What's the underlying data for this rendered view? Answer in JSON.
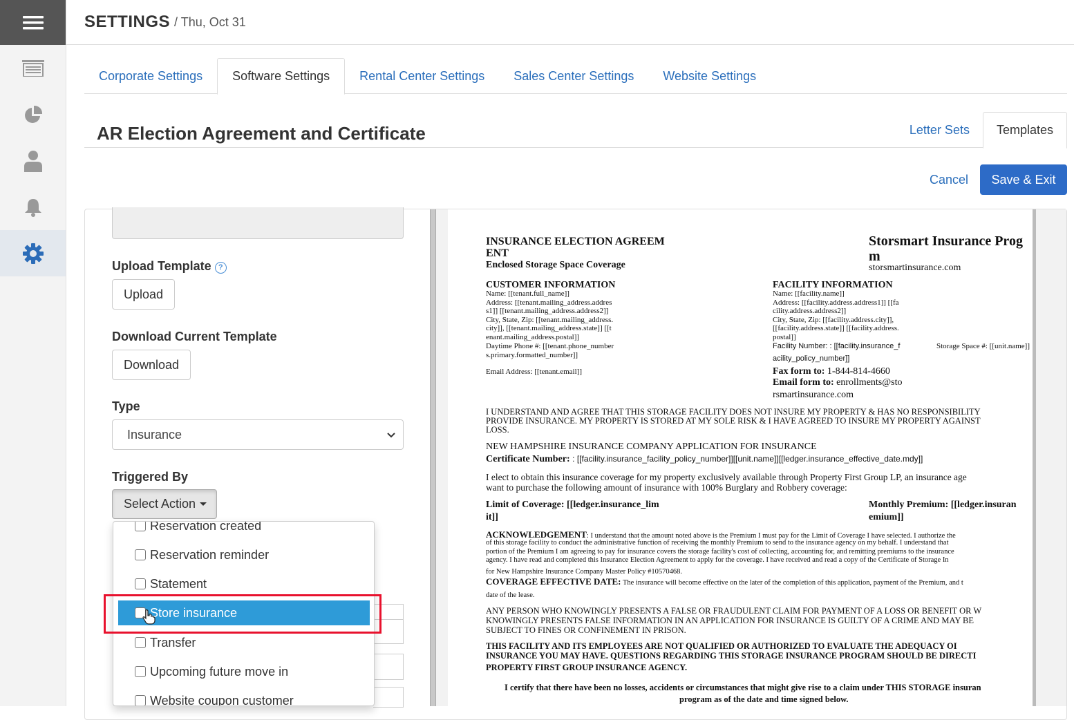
{
  "header": {
    "title": "SETTINGS",
    "date": "/ Thu, Oct 31"
  },
  "sidebar": {
    "icons": [
      "menu-icon",
      "list-icon",
      "pie-chart-icon",
      "user-icon",
      "bell-icon",
      "gear-icon"
    ]
  },
  "tabs": [
    {
      "label": "Corporate Settings"
    },
    {
      "label": "Software Settings",
      "active": true
    },
    {
      "label": "Rental Center Settings"
    },
    {
      "label": "Sales Center Settings"
    },
    {
      "label": "Website Settings"
    }
  ],
  "page": {
    "title": "AR Election Agreement and Certificate",
    "subtabs": [
      {
        "label": "Letter Sets"
      },
      {
        "label": "Templates",
        "active": true
      }
    ],
    "cancel": "Cancel",
    "save": "Save & Exit"
  },
  "form": {
    "upload_label": "Upload Template",
    "upload_btn": "Upload",
    "download_label": "Download Current Template",
    "download_btn": "Download",
    "type_label": "Type",
    "type_value": "Insurance",
    "triggered_label": "Triggered By",
    "action_btn": "Select Action",
    "actions": [
      {
        "label": "Reservation created",
        "checked": false
      },
      {
        "label": "Reservation reminder",
        "checked": false
      },
      {
        "label": "Statement",
        "checked": false
      },
      {
        "label": "Store insurance",
        "checked": false,
        "highlighted": true
      },
      {
        "label": "Transfer",
        "checked": false
      },
      {
        "label": "Upcoming future move in",
        "checked": false
      },
      {
        "label": "Website coupon customer",
        "checked": false
      }
    ]
  },
  "doc": {
    "title1": "INSURANCE ELECTION AGREEM",
    "title2": "ENT",
    "subtitle": "Enclosed Storage Space Coverage",
    "prog1": "Storsmart Insurance Prog",
    "prog2": "m",
    "site": "storsmartinsurance.com",
    "cust_h": "CUSTOMER INFORMATION",
    "cust_lines": [
      "Name: [[tenant.full_name]]",
      "Address: [[tenant.mailing_address.addres",
      "s1]] [[tenant.mailing_address.address2]]",
      "City, State, Zip: [[tenant.mailing_address.",
      "city]], [[tenant.mailing_address.state]] [[t",
      "enant.mailing_address.postal]]",
      "Daytime Phone #: [[tenant.phone_number",
      "s.primary.formatted_number]]"
    ],
    "cust_email": "Email Address: [[tenant.email]]",
    "fac_h": "FACILITY INFORMATION",
    "fac_lines": [
      "Name: [[facility.name]]",
      "Address: [[facility.address.address1]] [[fa",
      "cility.address.address2]]",
      "City, State, Zip: [[facility.address.city]],",
      "[[facility.address.state]] [[facility.address.",
      "postal]]"
    ],
    "fac_num": "Facility Number: : [[facility.insurance_f",
    "fac_space": "Storage Space #: [[unit.name]]",
    "fac_num2": "acility_policy_number]]",
    "fax_label": "Fax form to:",
    "fax_value": "1-844-814-4660",
    "email_label": "Email form to:",
    "email_value": "enrollments@sto",
    "email_value2": "rsmartinsurance.com",
    "understand": [
      "I UNDERSTAND AND AGREE THAT THIS STORAGE FACILITY DOES NOT INSURE MY PROPERTY & HAS NO RESPONSIBILITY",
      "PROVIDE INSURANCE.  MY PROPERTY IS STORED AT MY SOLE RISK & I HAVE AGREED TO INSURE MY PROPERTY AGAINST",
      "LOSS."
    ],
    "nh": "NEW HAMPSHIRE INSURANCE COMPANY APPLICATION FOR INSURANCE",
    "cert_label": "Certificate Number:",
    "cert_value": ": [[facility.insurance_facility_policy_number]][[unit.name]][[ledger.insurance_effective_date.mdy]]",
    "elect": [
      "I elect to obtain this insurance coverage for my property exclusively available through Property First Group LP, an insurance age",
      "want to purchase the following amount of insurance with 100% Burglary and Robbery coverage:"
    ],
    "limit1": "Limit of Coverage: [[ledger.insurance_lim",
    "limit2": "it]]",
    "premium1": "Monthly Premium: [[ledger.insuran",
    "premium2": "emium]]",
    "ack_label": "ACKNOWLEDGEMENT",
    "ack_lines": [
      ":  I understand that the amount noted above is the Premium I must pay for the Limit of Coverage I have selected.  I authorize the",
      "of this storage facility to conduct the administrative function of receiving the monthly Premium to send to the insurance agency on my behalf.  I understand that",
      "portion of the Premium I am agreeing to pay for insurance covers the storage facility's cost of collecting, accounting for, and remitting premiums to the insurance",
      "agency.  I have read and completed this Insurance Election Agreement to apply for the coverage.  I have received and read a copy of the Certificate of Storage In",
      "for New Hampshire Insurance Company Master Policy #10570468."
    ],
    "cov_label": "COVERAGE EFFECTIVE DATE:",
    "cov_text": "The insurance will become effective on the later of the completion of this application, payment of the Premium, and t",
    "cov_text2": "date of the lease.",
    "fraud": [
      "ANY PERSON WHO KNOWINGLY PRESENTS A FALSE OR FRAUDULENT CLAIM FOR PAYMENT OF A LOSS OR BENEFIT OR W",
      "KNOWINGLY PRESENTS FALSE INFORMATION IN AN APPLICATION FOR INSURANCE IS GUILTY OF A CRIME AND MAY BE",
      "SUBJECT TO FINES OR CONFINEMENT IN PRISON."
    ],
    "facility": [
      "THIS FACILITY AND ITS EMPLOYEES ARE NOT QUALIFIED OR AUTHORIZED TO EVALUATE THE ADEQUACY OI",
      "INSURANCE YOU MAY HAVE. QUESTIONS REGARDING THIS STORAGE INSURANCE PROGRAM SHOULD BE DIRECTI",
      "PROPERTY FIRST GROUP INSURANCE AGENCY."
    ],
    "certify1": "I certify that there have been no losses, accidents or circumstances that might give rise to a claim under THIS STORAGE insuran",
    "certify2": "program as of the date and time signed below."
  }
}
